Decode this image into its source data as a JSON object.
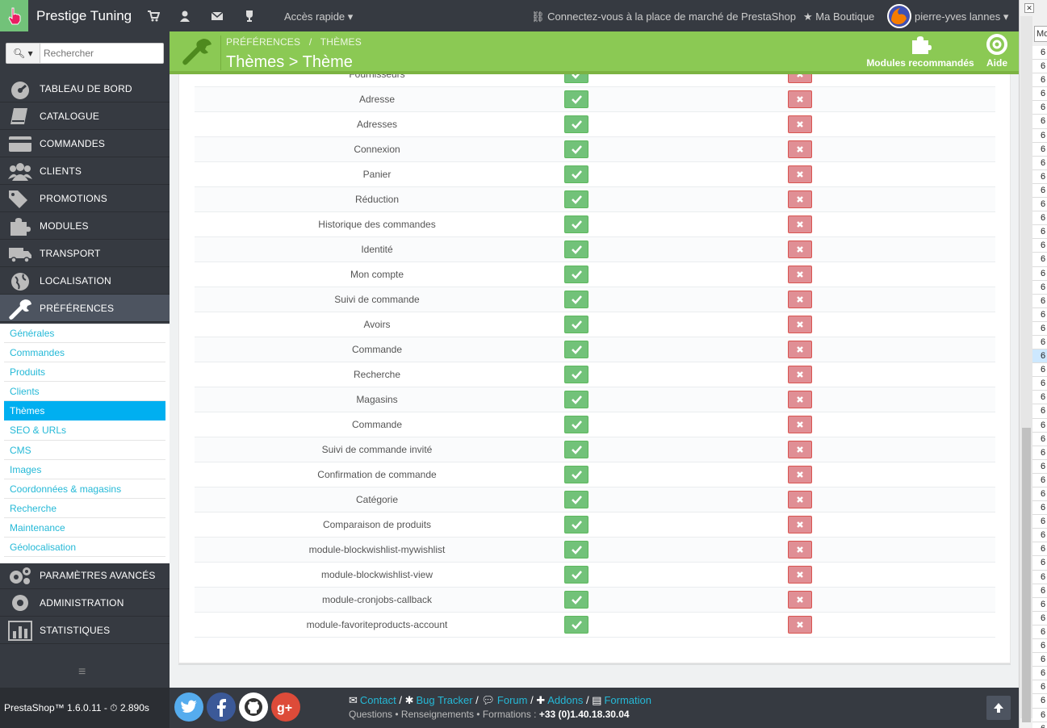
{
  "topbar": {
    "brand": "Prestige Tuning",
    "quick_access": "Accès rapide",
    "marketplace": "Connectez-vous à la place de marché de PrestaShop",
    "my_shop": "Ma Boutique",
    "user": "pierre-yves lannes"
  },
  "search": {
    "placeholder": "Rechercher"
  },
  "sidebar": {
    "items": [
      {
        "label": "TABLEAU DE BORD",
        "icon": "dashboard-icon"
      },
      {
        "label": "CATALOGUE",
        "icon": "book-icon"
      },
      {
        "label": "COMMANDES",
        "icon": "credit-card-icon"
      },
      {
        "label": "CLIENTS",
        "icon": "users-icon"
      },
      {
        "label": "PROMOTIONS",
        "icon": "tags-icon"
      },
      {
        "label": "MODULES",
        "icon": "puzzle-icon"
      },
      {
        "label": "TRANSPORT",
        "icon": "truck-icon"
      },
      {
        "label": "LOCALISATION",
        "icon": "globe-icon"
      },
      {
        "label": "PRÉFÉRENCES",
        "icon": "wrench-icon"
      }
    ],
    "sub_items": [
      "Générales",
      "Commandes",
      "Produits",
      "Clients",
      "Thèmes",
      "SEO & URLs",
      "CMS",
      "Images",
      "Coordonnées & magasins",
      "Recherche",
      "Maintenance",
      "Géolocalisation"
    ],
    "bottom_items": [
      {
        "label": "PARAMÈTRES AVANCÉS",
        "icon": "cogs-icon"
      },
      {
        "label": "ADMINISTRATION",
        "icon": "cog-icon"
      },
      {
        "label": "STATISTIQUES",
        "icon": "bar-chart-icon"
      }
    ]
  },
  "version": "PrestaShop™ 1.6.0.11 - ⏱ 2.890s",
  "header": {
    "breadcrumb": "PRÉFÉRENCES   /   THÈMES",
    "title": "Thèmes > Thème",
    "modules_label": "Modules recommandés",
    "help_label": "Aide"
  },
  "table": {
    "rows": [
      "Fournisseurs",
      "Adresse",
      "Adresses",
      "Connexion",
      "Panier",
      "Réduction",
      "Historique des commandes",
      "Identité",
      "Mon compte",
      "Suivi de commande",
      "Avoirs",
      "Commande",
      "Recherche",
      "Magasins",
      "Commande",
      "Suivi de commande invité",
      "Confirmation de commande",
      "Catégorie",
      "Comparaison de produits",
      "module-blockwishlist-mywishlist",
      "module-blockwishlist-view",
      "module-cronjobs-callback",
      "module-favoriteproducts-account"
    ]
  },
  "footer": {
    "links": [
      {
        "icon": "envelope-icon",
        "label": "Contact"
      },
      {
        "icon": "bug-icon",
        "label": "Bug Tracker"
      },
      {
        "icon": "comments-icon",
        "label": "Forum"
      },
      {
        "icon": "puzzle-icon",
        "label": "Addons"
      },
      {
        "icon": "book-icon",
        "label": "Formation"
      }
    ],
    "contact_prefix": "Questions • Renseignements • Formations : ",
    "phone": "+33 (0)1.40.18.30.04"
  },
  "rpanel": {
    "input_value": "Mo",
    "row_label": "6",
    "row_count": 50
  },
  "colors": {
    "header_green": "#8bc954",
    "sidebar_dark": "#363a41",
    "active_blue": "#00aff0",
    "link_blue": "#25b9d7",
    "yes_green": "#72c279",
    "no_red": "#e08f95"
  }
}
